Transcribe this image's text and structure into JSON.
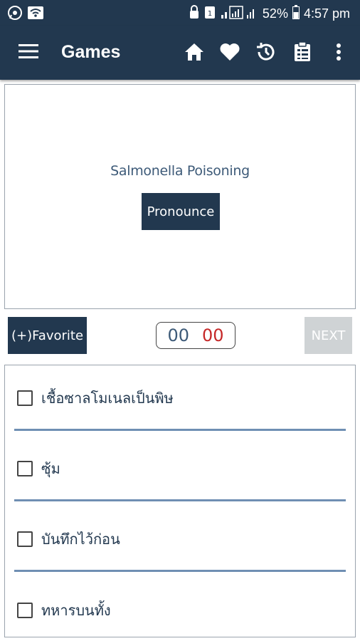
{
  "status_bar": {
    "battery": "52%",
    "time": "4:57 pm"
  },
  "app_bar": {
    "title": "Games"
  },
  "card": {
    "word": "Salmonella Poisoning",
    "pronounce_label": "Pronounce"
  },
  "controls": {
    "favorite_label": "(+)Favorite",
    "timer_minutes": "00",
    "timer_seconds": "00",
    "next_label": "NEXT"
  },
  "options": [
    {
      "label": "เชื้อซาลโมเนลเป็นพิษ"
    },
    {
      "label": "ซุ้ม"
    },
    {
      "label": "บันทึกไว้ก่อน"
    },
    {
      "label": "ทหารบนทั้ง"
    }
  ],
  "colors": {
    "primary": "#22384f",
    "accent_text": "#3d5a78",
    "timer_seconds": "#c62828",
    "next_disabled": "#cfd3d5",
    "divider": "#6f8fb3"
  },
  "icons": [
    "whatsapp-icon",
    "wifi-icon",
    "lock-icon",
    "notification-icon",
    "signal-icon",
    "battery-icon",
    "menu-icon",
    "home-icon",
    "heart-icon",
    "history-icon",
    "clipboard-icon",
    "more-vert-icon"
  ]
}
